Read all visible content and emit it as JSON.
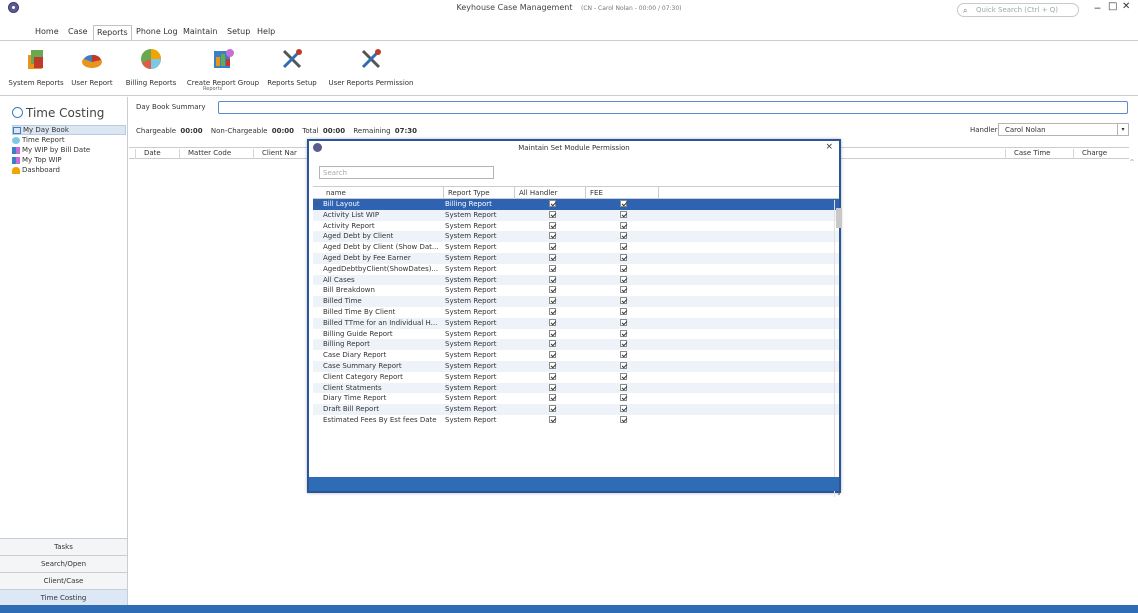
{
  "window": {
    "title": "Keyhouse Case Management",
    "subtitle": "(CN - Carol Nolan - 00:00 / 07:30)",
    "quick_search_placeholder": "Quick Search (Ctrl + Q)",
    "minimize": "‒",
    "maximize": "□",
    "close": "✕"
  },
  "menu": [
    "Home",
    "Case",
    "Reports",
    "Phone Log",
    "Maintain",
    "Setup",
    "Help"
  ],
  "ribbon": {
    "buttons": [
      {
        "label": "System Reports",
        "icon": "system-reports-icon"
      },
      {
        "label": "User Report",
        "icon": "user-report-icon"
      },
      {
        "label": "Billing Reports",
        "icon": "billing-reports-icon"
      },
      {
        "label": "Create Report Group",
        "icon": "create-report-group-icon"
      },
      {
        "label": "Reports Setup",
        "icon": "reports-setup-icon"
      },
      {
        "label": "User Reports Permission",
        "icon": "user-reports-permission-icon"
      }
    ],
    "group_label": "Reports"
  },
  "nav": {
    "header": "Time Costing",
    "items": [
      "My Day Book",
      "Time Report",
      "My WIP by Bill Date",
      "My Top WIP",
      "Dashboard"
    ],
    "bottom": [
      "Tasks",
      "Search/Open",
      "Client/Case",
      "Time Costing"
    ]
  },
  "content": {
    "day_book_label": "Day Book Summary",
    "summary": {
      "chargeable_label": "Chargeable",
      "chargeable": "00:00",
      "nonchargeable_label": "Non-Chargeable",
      "nonchargeable": "00:00",
      "total_label": "Total",
      "total": "00:00",
      "remaining_label": "Remaining",
      "remaining": "07:30"
    },
    "handler_label": "Handler",
    "handler_value": "Carol Nolan",
    "grid_headers": [
      "Date",
      "Matter Code",
      "Client Nar",
      "Case Time",
      "Charge"
    ]
  },
  "dialog": {
    "title": "Maintain Set Module Permission",
    "close": "×",
    "search_placeholder": "Search",
    "headers": [
      "name",
      "Report Type",
      "All Handler",
      "FEE"
    ],
    "rows": [
      {
        "name": "Bill Layout",
        "type": "Billing Report"
      },
      {
        "name": "Activity List WIP",
        "type": "System Report"
      },
      {
        "name": "Activity Report",
        "type": "System Report"
      },
      {
        "name": "Aged Debt by Client",
        "type": "System Report"
      },
      {
        "name": "Aged Debt by Client (Show Dat...",
        "type": "System Report"
      },
      {
        "name": "Aged Debt by Fee Earner",
        "type": "System Report"
      },
      {
        "name": "AgedDebtbyClient(ShowDates)...",
        "type": "System Report"
      },
      {
        "name": "All Cases",
        "type": "System Report"
      },
      {
        "name": "Bill Breakdown",
        "type": "System Report"
      },
      {
        "name": "Billed Time",
        "type": "System Report"
      },
      {
        "name": "Billed Time By Client",
        "type": "System Report"
      },
      {
        "name": "Billed TTme for an Individual H...",
        "type": "System Report"
      },
      {
        "name": "Billing Guide Report",
        "type": "System Report"
      },
      {
        "name": "Billing Report",
        "type": "System Report"
      },
      {
        "name": "Case Diary Report",
        "type": "System Report"
      },
      {
        "name": "Case Summary Report",
        "type": "System Report"
      },
      {
        "name": "Client Category Report",
        "type": "System Report"
      },
      {
        "name": "Client Statments",
        "type": "System Report"
      },
      {
        "name": "Diary Time Report",
        "type": "System Report"
      },
      {
        "name": "Draft Bill Report",
        "type": "System Report"
      },
      {
        "name": "Estimated Fees By Est fees Date",
        "type": "System Report"
      }
    ]
  }
}
